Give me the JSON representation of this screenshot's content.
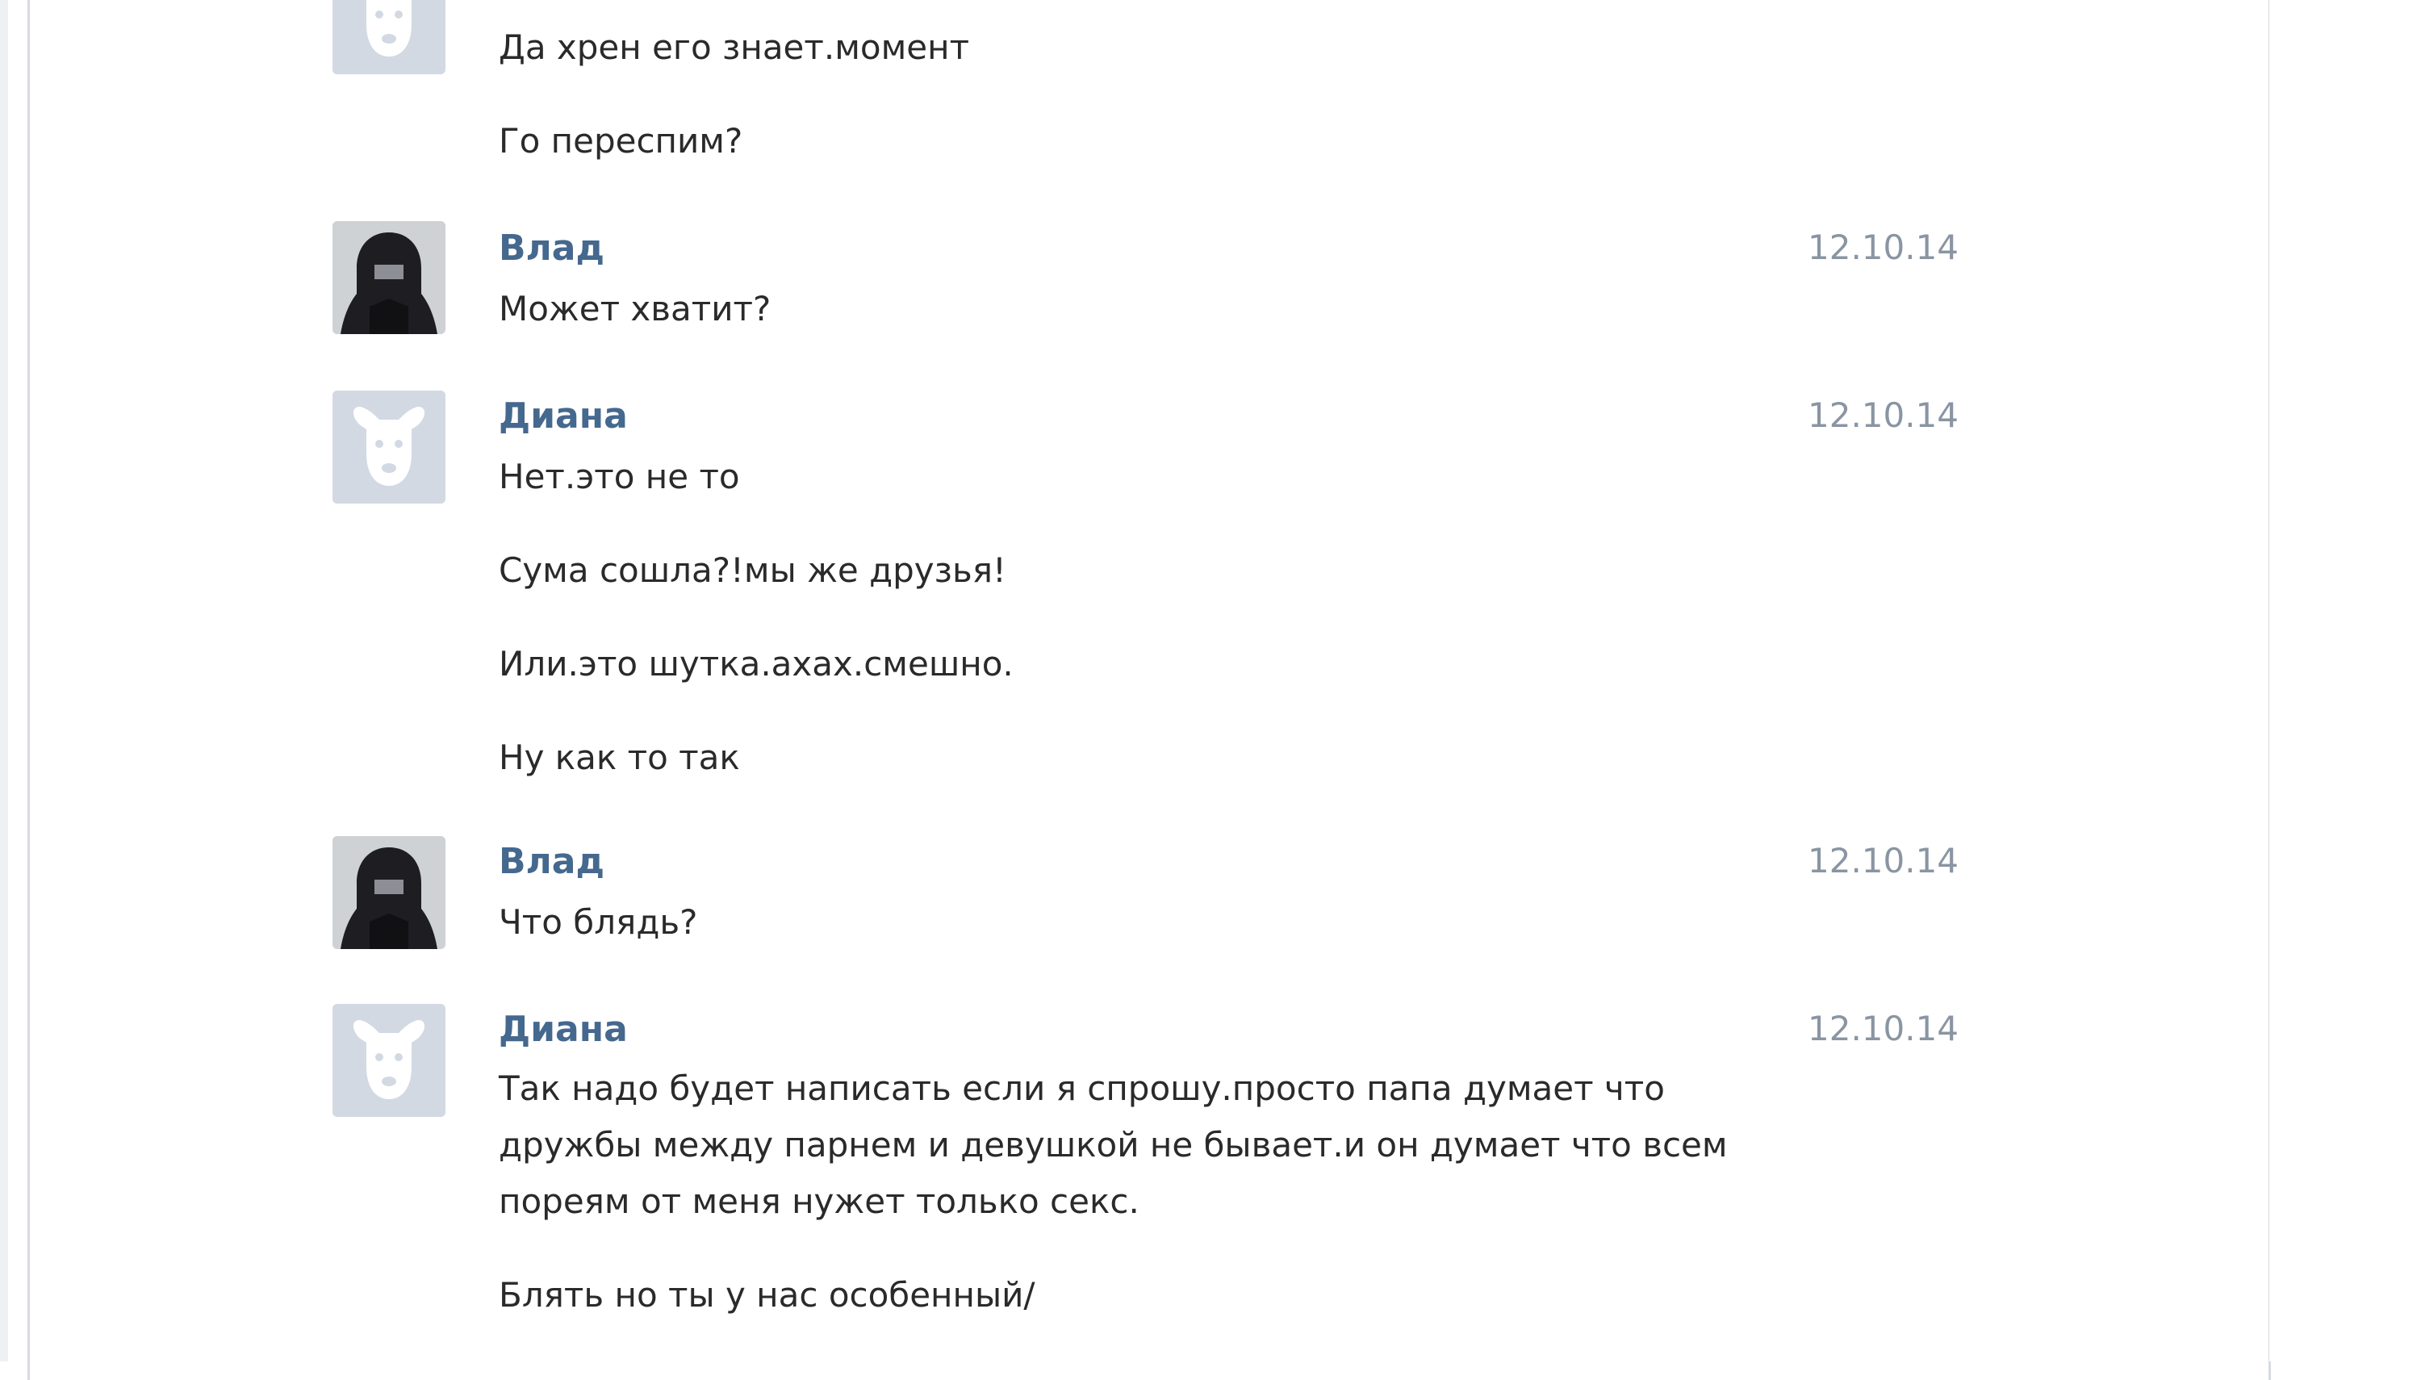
{
  "messages": [
    {
      "author": "",
      "date": "",
      "avatar": "dog-icon",
      "lines": [
        "Да хрен его знает.момент",
        "Го переспим?"
      ]
    },
    {
      "author": "Влад",
      "date": "12.10.14",
      "avatar": "hooded-user-icon",
      "lines": [
        "Может хватит?"
      ]
    },
    {
      "author": "Диана",
      "date": "12.10.14",
      "avatar": "dog-icon",
      "lines": [
        "Нет.это не то",
        "Сума сошла?!мы же друзья!",
        "Или.это шутка.ахах.смешно.",
        "Ну как то так"
      ]
    },
    {
      "author": "Влад",
      "date": "12.10.14",
      "avatar": "hooded-user-icon",
      "lines": [
        "Что блядь?"
      ]
    },
    {
      "author": "Диана",
      "date": "12.10.14",
      "avatar": "dog-icon",
      "lines": [
        "Так надо будет написать если я спрошу.просто папа думает что дружбы между парнем и девушкой не бывает.и он думает что всем пореям от меня нужет только секс.",
        "Блять но ты у нас особенный/"
      ]
    }
  ],
  "colors": {
    "author_name": "#45688e",
    "date": "#8a95a3",
    "message_text": "#2a2a2a",
    "panel_border": "#d7dbe0"
  }
}
